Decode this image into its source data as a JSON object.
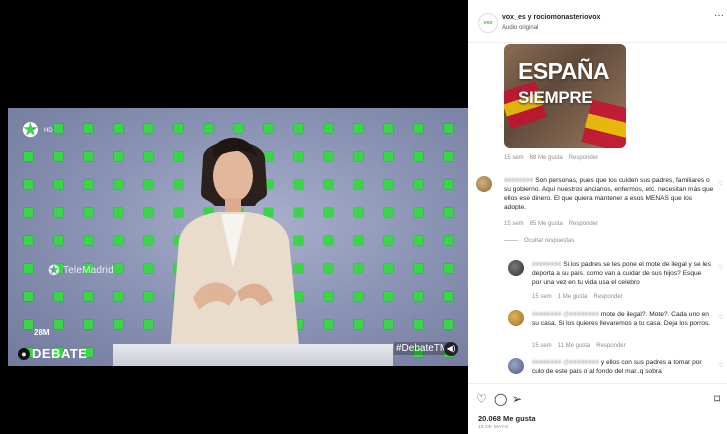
{
  "video": {
    "channel_hd": "HD",
    "channel_name": "TeleMadrid",
    "debate_date": "28M",
    "debate_word": "DEBATE",
    "hashtag": "#DebateTM"
  },
  "post": {
    "username": "vox_es y rociomonasteriovox",
    "audio": "Audio original",
    "image_line1": "ESPAÑA",
    "image_line2": "SIEMPRE",
    "image_meta": {
      "time": "15 sem",
      "likes": "88 Me gusta",
      "reply": "Responder"
    }
  },
  "comments": [
    {
      "user": "########",
      "text": "Son personas, pues que los cuiden sus padres, familiares o su gobierno. Aquí nuestros ancianos, enfermos, etc. necesitan más que ellos ese dinero. El que quiera mantener a esos MENAS que los adopte.",
      "time": "15 sem",
      "likes": "85 Me gusta",
      "reply": "Responder"
    }
  ],
  "hide_replies": "Ocultar respuestas",
  "replies": [
    {
      "user": "########",
      "text": "Si los padres se les pone el mote de ilegal y se les deporta a su país. como van a cuidar de sus hijos? Esque por una vez en tu vida usa el celebro",
      "time": "15 sem",
      "likes": "1 Me gusta",
      "reply": "Responder"
    },
    {
      "user": "########",
      "mention": "@########",
      "text": "mote de ilegal?. Mote?. Cada uno en su casa. Si los quieres llevaremos a tu casa. Deja los porros.",
      "time": "15 sem",
      "likes": "11 Me gusta",
      "reply": "Responder"
    },
    {
      "user": "########",
      "mention": "@########",
      "text": "y ellos con sus padres a tomar por culo de este país o al fondo del mar..q sobra"
    }
  ],
  "footer": {
    "likes": "20.068 Me gusta",
    "date": "18 DE MAYO"
  },
  "icons": {
    "heart": "heart-icon",
    "comment": "comment-icon",
    "share": "share-icon",
    "save": "bookmark-icon",
    "more": "more-icon"
  },
  "colors": {
    "accent_green": "#3ad548",
    "vox_green": "#5ab031"
  }
}
